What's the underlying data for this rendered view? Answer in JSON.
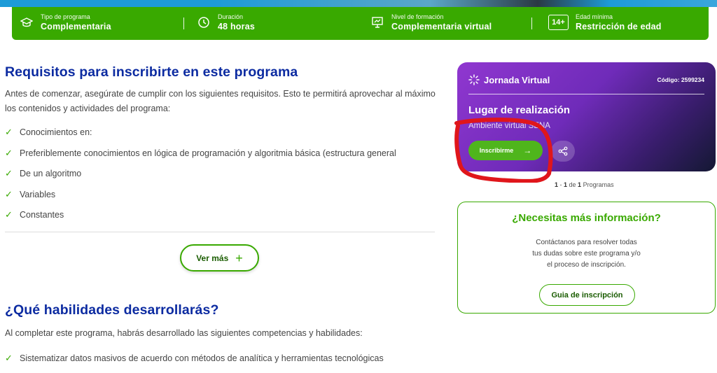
{
  "info_bar": {
    "items": [
      {
        "label": "Tipo de programa",
        "value": "Complementaria",
        "icon": "graduation-cap-icon"
      },
      {
        "label": "Duración",
        "value": "48 horas",
        "icon": "clock-icon"
      },
      {
        "label": "Nivel de formación",
        "value": "Complementaria virtual",
        "icon": "presentation-icon"
      },
      {
        "label": "Edad mínima",
        "value": "Restricción de edad",
        "icon": "age-badge-icon",
        "badge": "14+"
      }
    ]
  },
  "requisitos": {
    "heading": "Requisitos para inscribirte en este programa",
    "intro": "Antes de comenzar, asegúrate de cumplir con los siguientes requisitos. Esto te permitirá aprovechar al máximo los contenidos y actividades del programa:",
    "items": [
      "Conocimientos en:",
      "Preferiblemente conocimientos en lógica de programación y algoritmia básica (estructura general",
      "De un algoritmo",
      "Variables",
      "Constantes"
    ],
    "ver_mas": "Ver más",
    "ver_mas_icon": "+"
  },
  "habilidades": {
    "heading": "¿Qué habilidades desarrollarás?",
    "intro": "Al completar este programa, habrás desarrollado las siguientes competencias y habilidades:",
    "items": [
      "Sistematizar datos masivos de acuerdo con métodos de analítica y herramientas tecnológicas"
    ]
  },
  "program_card": {
    "jornada": "Jornada Virtual",
    "codigo": "Código: 2599234",
    "lugar_label": "Lugar de realización",
    "lugar_value": "Ambiente virtual SENA",
    "inscribirme": "Inscribirme",
    "arrow": "→"
  },
  "pager": {
    "from": "1",
    "dash": " - ",
    "to": "1",
    "of": " de ",
    "total": "1",
    "label": " Programas"
  },
  "more_info": {
    "title": "¿Necesitas más información?",
    "line1": "Contáctanos para resolver todas",
    "line2": "tus dudas sobre este programa y/o",
    "line3": "el proceso de inscripción.",
    "guia": "Guia de inscripción"
  },
  "colors": {
    "green": "#39a900",
    "blue_heading": "#0c2ba1",
    "purple": "#7a2fc4",
    "annotation_red": "#e0161b"
  }
}
